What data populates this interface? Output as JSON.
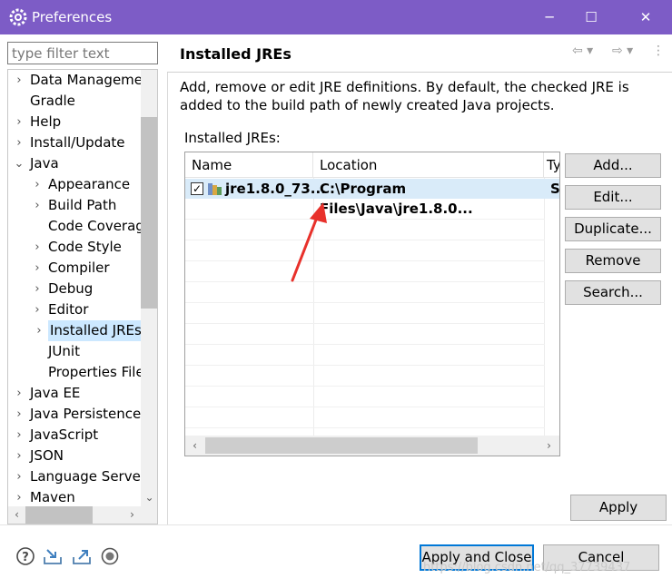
{
  "window": {
    "title": "Preferences",
    "controls": {
      "minimize": "─",
      "maximize": "☐",
      "close": "✕"
    }
  },
  "filter": {
    "placeholder": "type filter text",
    "value": ""
  },
  "tree": {
    "items": [
      {
        "label": "Data Manageme",
        "level": 0,
        "arrow": "›",
        "selected": false
      },
      {
        "label": "Gradle",
        "level": 0,
        "arrow": "",
        "selected": false
      },
      {
        "label": "Help",
        "level": 0,
        "arrow": "›",
        "selected": false
      },
      {
        "label": "Install/Update",
        "level": 0,
        "arrow": "›",
        "selected": false
      },
      {
        "label": "Java",
        "level": 0,
        "arrow": "⌄",
        "selected": false
      },
      {
        "label": "Appearance",
        "level": 1,
        "arrow": "›",
        "selected": false
      },
      {
        "label": "Build Path",
        "level": 1,
        "arrow": "›",
        "selected": false
      },
      {
        "label": "Code Coverag",
        "level": 1,
        "arrow": "",
        "selected": false
      },
      {
        "label": "Code Style",
        "level": 1,
        "arrow": "›",
        "selected": false
      },
      {
        "label": "Compiler",
        "level": 1,
        "arrow": "›",
        "selected": false
      },
      {
        "label": "Debug",
        "level": 1,
        "arrow": "›",
        "selected": false
      },
      {
        "label": "Editor",
        "level": 1,
        "arrow": "›",
        "selected": false
      },
      {
        "label": "Installed JREs",
        "level": 1,
        "arrow": "›",
        "selected": true
      },
      {
        "label": "JUnit",
        "level": 1,
        "arrow": "",
        "selected": false
      },
      {
        "label": "Properties File",
        "level": 1,
        "arrow": "",
        "selected": false
      },
      {
        "label": "Java EE",
        "level": 0,
        "arrow": "›",
        "selected": false
      },
      {
        "label": "Java Persistence",
        "level": 0,
        "arrow": "›",
        "selected": false
      },
      {
        "label": "JavaScript",
        "level": 0,
        "arrow": "›",
        "selected": false
      },
      {
        "label": "JSON",
        "level": 0,
        "arrow": "›",
        "selected": false
      },
      {
        "label": "Language Server",
        "level": 0,
        "arrow": "›",
        "selected": false
      },
      {
        "label": "Maven",
        "level": 0,
        "arrow": "›",
        "selected": false
      }
    ]
  },
  "page": {
    "title": "Installed JREs",
    "description": "Add, remove or edit JRE definitions. By default, the checked JRE is added to the build path of newly created Java projects.",
    "list_label": "Installed JREs:",
    "nav_icons": [
      "back-arrow-icon",
      "forward-arrow-icon",
      "view-menu-icon"
    ]
  },
  "table": {
    "columns": [
      "Name",
      "Location",
      "Ty"
    ],
    "rows": [
      {
        "checked": true,
        "name": "jre1.8.0_73...",
        "location": "C:\\Program Files\\Java\\jre1.8.0...",
        "type": "S"
      }
    ]
  },
  "buttons": {
    "add": "Add...",
    "edit": "Edit...",
    "duplicate": "Duplicate...",
    "remove": "Remove",
    "search": "Search...",
    "apply": "Apply",
    "apply_close": "Apply and Close",
    "cancel": "Cancel"
  },
  "footer_icons": [
    "help-icon",
    "import-icon",
    "export-icon",
    "record-icon"
  ],
  "watermark": "https://blog.csdn.net/qq_37739437",
  "colors": {
    "titlebar": "#7d5cc6",
    "selection": "#cce8ff",
    "annotation_arrow": "#e8312b"
  }
}
